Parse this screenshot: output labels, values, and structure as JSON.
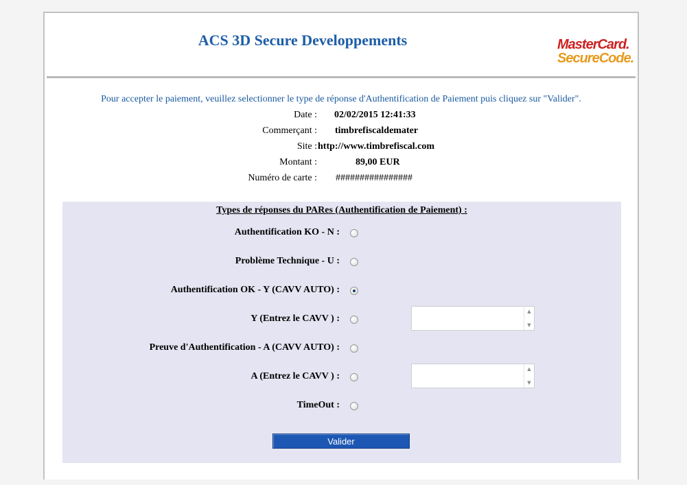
{
  "header": {
    "title": "ACS 3D Secure Developpements",
    "logo": {
      "line1": "MasterCard.",
      "line2": "SecureCode."
    }
  },
  "intro": "Pour accepter le paiement, veuillez selectionner le type de réponse d'Authentification de Paiement puis cliquez sur \"Valider\".",
  "transaction": [
    {
      "label": "Date :",
      "value": "02/02/2015 12:41:33"
    },
    {
      "label": "Commerçant :",
      "value": "timbrefiscaldemater"
    },
    {
      "label": "Site :",
      "value": "http://www.timbrefiscal.com"
    },
    {
      "label": "Montant :",
      "value": "89,00 EUR"
    },
    {
      "label": "Numéro de carte :",
      "value": "################"
    }
  ],
  "form": {
    "title": "Types de réponses du PARes (Authentification de Paiement) :",
    "options": [
      {
        "label": "Authentification KO - N :",
        "checked": false
      },
      {
        "label": "Problème Technique - U :",
        "checked": false
      },
      {
        "label": "Authentification OK - Y (CAVV AUTO) :",
        "checked": true
      },
      {
        "label": "Y (Entrez le CAVV ) :",
        "checked": false
      },
      {
        "label": "Preuve d'Authentification - A (CAVV AUTO) :",
        "checked": false
      },
      {
        "label": "A (Entrez le CAVV ) :",
        "checked": false
      },
      {
        "label": "TimeOut :",
        "checked": false
      }
    ],
    "cavv_y": "",
    "cavv_a": "",
    "submit_label": "Valider"
  },
  "colors": {
    "title": "#1d5ea8",
    "panel": "#e4e4f2",
    "button": "#1c57b4",
    "logo_red": "#cc2222",
    "logo_orange": "#e69a1c"
  }
}
